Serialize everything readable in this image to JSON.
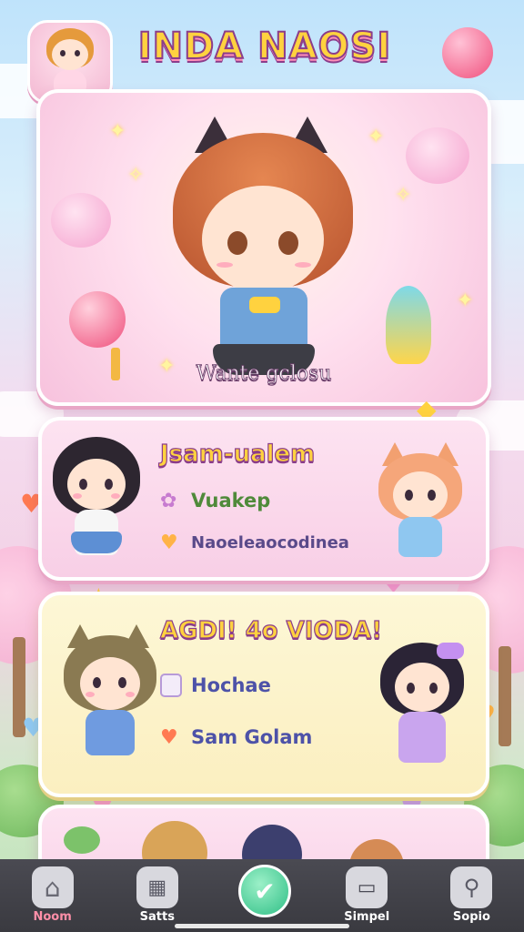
{
  "app": {
    "title": "INDA NAOSI"
  },
  "hero": {
    "caption": "Wante gclosu"
  },
  "card2": {
    "title": "Jsam-ualem",
    "rows": [
      {
        "icon": "flower-icon",
        "label": "Vuakep",
        "color": "#4f8a3a"
      },
      {
        "icon": "heart-icon",
        "label": "Naoeleaocodinea",
        "color": "#5a4a8a"
      }
    ]
  },
  "card3": {
    "title": "AGDI! 4o VIODA!",
    "rows": [
      {
        "icon": "calendar-icon",
        "label": "Hochae",
        "color": "#4d52a8"
      },
      {
        "icon": "heart-icon",
        "label": "Sam Golam",
        "color": "#4d52a8"
      }
    ]
  },
  "nav": {
    "items": [
      {
        "label": "Noom",
        "icon": "home-icon",
        "active": true
      },
      {
        "label": "Satts",
        "icon": "calendar-icon",
        "active": false
      },
      {
        "label": "",
        "icon": "check-heart-icon",
        "active": false
      },
      {
        "label": "Simpel",
        "icon": "chat-icon",
        "active": false
      },
      {
        "label": "Sopio",
        "icon": "search-icon",
        "active": false
      }
    ]
  },
  "colors": {
    "accent_pink": "#f0507d",
    "title_yellow": "#ffd23f",
    "outline_purple": "#8b3d8b",
    "nav_bg": "#3a3a40",
    "nav_active": "#ff8fa8"
  }
}
